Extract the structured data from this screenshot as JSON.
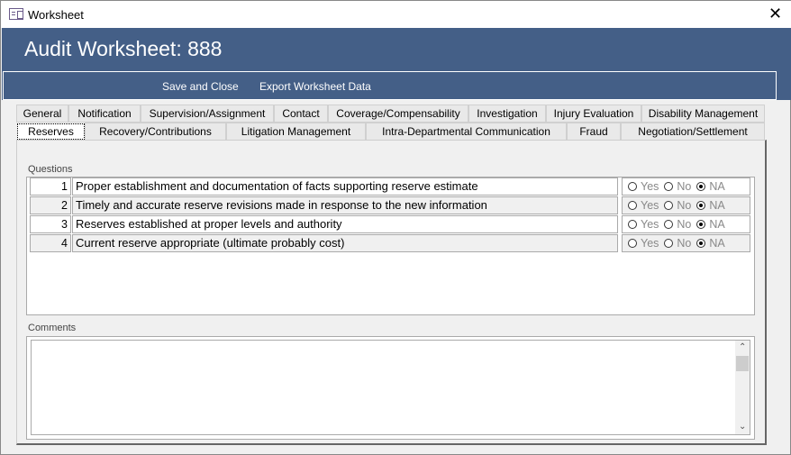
{
  "window": {
    "title": "Worksheet",
    "close": "✕"
  },
  "header": {
    "title": "Audit Worksheet: 888",
    "buttons": {
      "save": "Save and Close",
      "export": "Export Worksheet Data"
    }
  },
  "tabs_row1": [
    "General",
    "Notification",
    "Supervision/Assignment",
    "Contact",
    "Coverage/Compensability",
    "Investigation",
    "Injury Evaluation",
    "Disability Management"
  ],
  "tabs_row2": [
    "Reserves",
    "Recovery/Contributions",
    "Litigation Management",
    "Intra-Departmental Communication",
    "Fraud",
    "Negotiation/Settlement"
  ],
  "selected_tab": "Reserves",
  "questions_label": "Questions",
  "option_labels": [
    "Yes",
    "No",
    "NA"
  ],
  "questions": [
    {
      "num": "1",
      "text": "Proper establishment and documentation of facts supporting reserve estimate",
      "answer": "NA"
    },
    {
      "num": "2",
      "text": "Timely and accurate reserve revisions made in response to the new information",
      "answer": "NA"
    },
    {
      "num": "3",
      "text": "Reserves established at proper levels and authority",
      "answer": "NA"
    },
    {
      "num": "4",
      "text": "Current reserve appropriate (ultimate probably cost)",
      "answer": "NA"
    }
  ],
  "comments_label": "Comments",
  "comments_value": ""
}
